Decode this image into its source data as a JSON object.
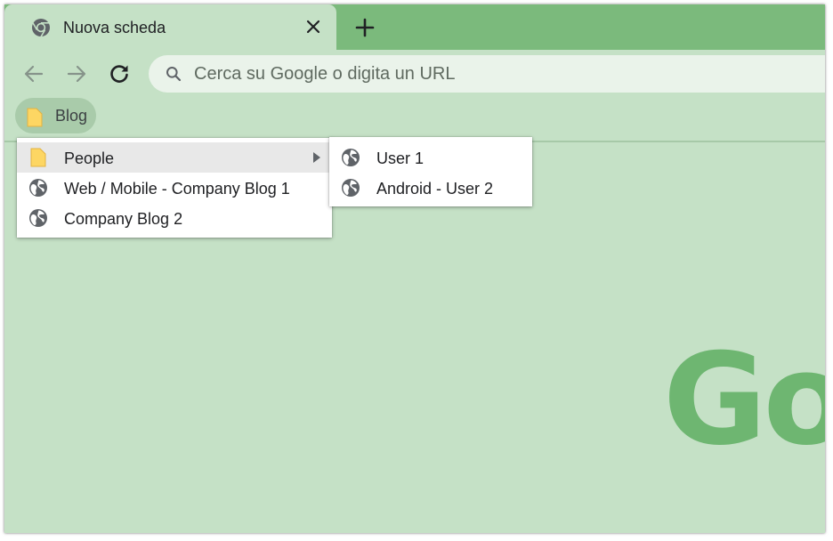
{
  "tab": {
    "title": "Nuova scheda",
    "favicon": "chrome-icon",
    "close_icon": "close-icon"
  },
  "new_tab_icon": "plus-icon",
  "toolbar": {
    "back_icon": "arrow-left-icon",
    "forward_icon": "arrow-right-icon",
    "reload_icon": "reload-icon"
  },
  "omnibox": {
    "icon": "search-icon",
    "placeholder": "Cerca su Google o digita un URL"
  },
  "bookmarks_bar": {
    "items": [
      {
        "label": "Blog",
        "icon": "folder-icon"
      }
    ]
  },
  "bookmark_menu": {
    "items": [
      {
        "label": "People",
        "icon": "folder-icon",
        "has_submenu": true,
        "highlighted": true
      },
      {
        "label": "Web / Mobile - Company Blog 1",
        "icon": "globe-icon"
      },
      {
        "label": "Company Blog 2",
        "icon": "globe-icon"
      }
    ]
  },
  "submenu": {
    "items": [
      {
        "label": "User 1",
        "icon": "globe-icon"
      },
      {
        "label": "Android - User 2",
        "icon": "globe-icon"
      }
    ]
  },
  "logo_text": "Go",
  "colors": {
    "theme_frame": "#7bba7c",
    "theme_toolbar": "#c5e1c6",
    "logo": "#6eb671",
    "menu_highlight": "#e8e8e8"
  }
}
